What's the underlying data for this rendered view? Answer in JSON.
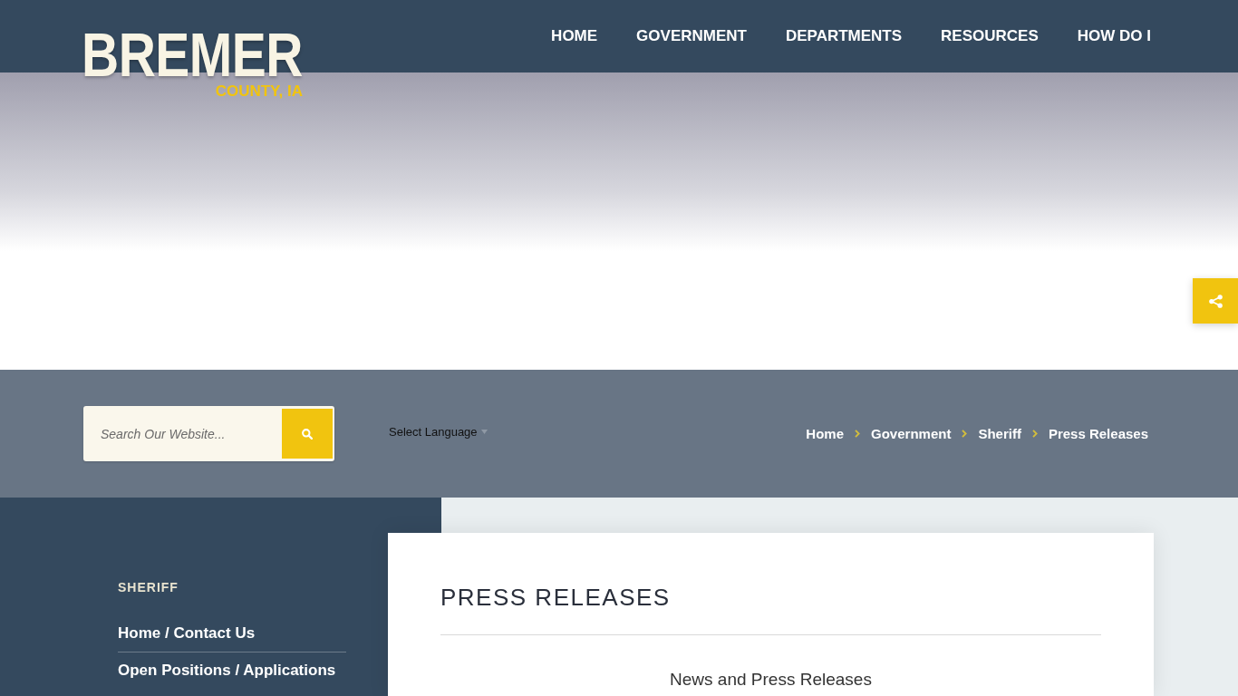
{
  "header": {
    "logo": {
      "title": "BREMER",
      "subtitle": "COUNTY, IA"
    },
    "nav": [
      {
        "label": "HOME"
      },
      {
        "label": "GOVERNMENT"
      },
      {
        "label": "DEPARTMENTS"
      },
      {
        "label": "RESOURCES"
      },
      {
        "label": "HOW DO I"
      }
    ]
  },
  "search": {
    "placeholder": "Search Our Website..."
  },
  "language": {
    "label": "Select Language"
  },
  "breadcrumb": [
    {
      "label": "Home"
    },
    {
      "label": "Government"
    },
    {
      "label": "Sheriff"
    },
    {
      "label": "Press Releases"
    }
  ],
  "sidebar": {
    "title": "SHERIFF",
    "items": [
      {
        "label": "Home / Contact Us"
      },
      {
        "label": "Open Positions / Applications"
      }
    ]
  },
  "content": {
    "title": "PRESS RELEASES",
    "subtitle": "News and Press Releases"
  }
}
